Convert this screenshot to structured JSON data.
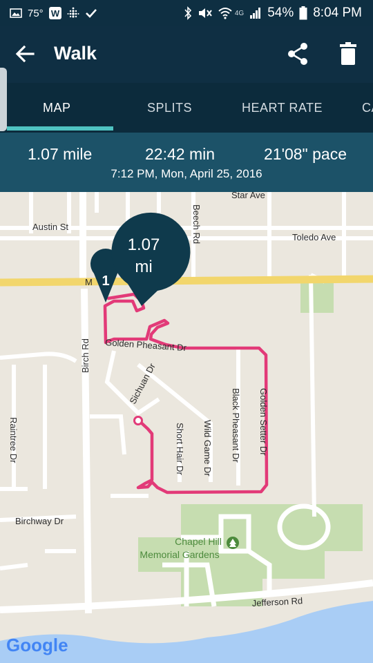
{
  "status_bar": {
    "temperature": "75°",
    "battery": "54%",
    "time": "8:04 PM",
    "network": "4G"
  },
  "app_bar": {
    "title": "Walk",
    "icons": [
      "back-arrow-icon",
      "share-icon",
      "trash-icon"
    ]
  },
  "tabs": [
    {
      "label": "MAP"
    },
    {
      "label": "SPLITS"
    },
    {
      "label": "HEART RATE"
    },
    {
      "label": "CA"
    }
  ],
  "stats": {
    "distance": "1.07 mile",
    "duration": "22:42 min",
    "pace": "21'08\" pace",
    "datetime": "7:12 PM, Mon, April 25, 2016"
  },
  "map": {
    "marker_total_value": "1.07",
    "marker_total_unit": "mi",
    "marker_split": "1",
    "attribution": "Google",
    "labels": {
      "star_ave": "Star Ave",
      "austin_st": "Austin St",
      "beech_rd": "Beech Rd",
      "toledo_ave": "Toledo Ave",
      "m_road": "M",
      "birch_rd": "Birch Rd",
      "golden_pheasant": "Golden Pheasant Dr",
      "sichuan": "Sichuan Dr",
      "short_hair": "Short Hair Dr",
      "wild_game": "Wild Game Dr",
      "black_pheasant": "Black Pheasant Dr",
      "golden_setter": "Golden Setter Dr",
      "raintree": "Raintree Dr",
      "birchway": "Birchway Dr",
      "chapel_hill_1": "Chapel Hill",
      "chapel_hill_2": "Memorial Gardens",
      "jefferson": "Jefferson Rd"
    },
    "colors": {
      "route": "#e23a78",
      "highway": "#f2d66c",
      "park": "#c4dcae",
      "water": "#a9cdf5",
      "marker": "#0f3a4c"
    }
  }
}
